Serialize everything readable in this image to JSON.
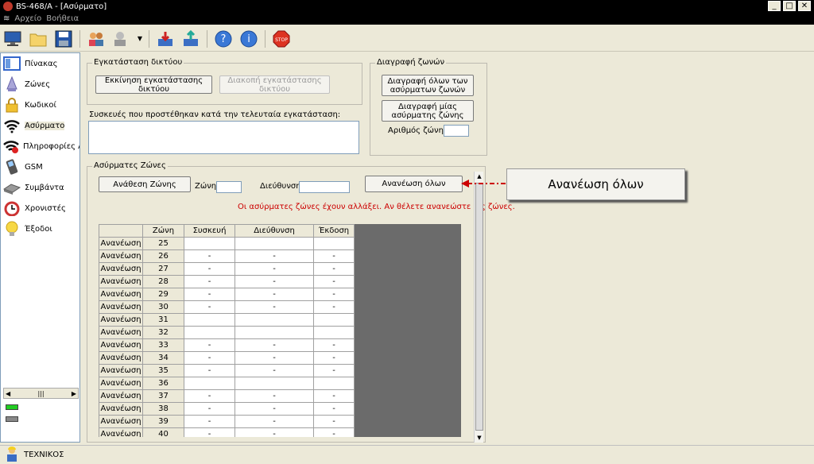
{
  "window": {
    "title": "BS-468/A - [Ασύρματο]",
    "min": "_",
    "max": "□",
    "close": "✕"
  },
  "menu": {
    "items": [
      "Αρχείο",
      "Βοήθεια"
    ]
  },
  "sidebar": {
    "items": [
      {
        "label": "Πίνακας",
        "icon": "panel-icon"
      },
      {
        "label": "Ζώνες",
        "icon": "zones-icon"
      },
      {
        "label": "Κωδικοί",
        "icon": "lock-icon"
      },
      {
        "label": "Ασύρματο",
        "icon": "wifi-icon"
      },
      {
        "label": "Πληροφορίες Ασ",
        "icon": "wifi-info-icon"
      },
      {
        "label": "GSM",
        "icon": "phone-icon"
      },
      {
        "label": "Συμβάντα",
        "icon": "events-icon"
      },
      {
        "label": "Χρονιστές",
        "icon": "clock-icon"
      },
      {
        "label": "Έξοδοι",
        "icon": "bulb-icon"
      }
    ],
    "selected": 3
  },
  "network": {
    "legend": "Εγκατάσταση δικτύου",
    "start_btn": "Εκκίνηση εγκατάστασης δικτύου",
    "stop_btn": "Διακοπή εγκατάστασης δικτύου",
    "devices_label": "Συσκευές που προστέθηκαν κατά την τελευταία εγκατάσταση:"
  },
  "delete": {
    "legend": "Διαγραφή ζωνών",
    "all_btn": "Διαγραφή όλων των ασύρματων ζωνών",
    "one_btn": "Διαγραφή μίας ασύρματης ζώνης",
    "zone_num_label": "Αριθμός ζώνης:",
    "zone_num_value": ""
  },
  "wireless": {
    "legend": "Ασύρματες Ζώνες",
    "assign_btn": "Ανάθεση Ζώνης",
    "zone_label": "Ζώνη",
    "zone_value": "",
    "address_label": "Διεύθυνση",
    "address_value": "",
    "refresh_all_btn": "Ανανέωση όλων",
    "warning": "Οι ασύρματες ζώνες έχουν αλλάξει. Αν θέλετε ανανεώστε τις ζώνες.",
    "warning_color": "#cc0000",
    "columns": [
      "",
      "Ζώνη",
      "Συσκευή",
      "Διεύθυνση",
      "Έκδοση"
    ],
    "rows": [
      {
        "action": "Ανανέωση",
        "zone": "25",
        "device": "",
        "address": "",
        "version": ""
      },
      {
        "action": "Ανανέωση",
        "zone": "26",
        "device": "-",
        "address": "-",
        "version": "-"
      },
      {
        "action": "Ανανέωση",
        "zone": "27",
        "device": "-",
        "address": "-",
        "version": "-"
      },
      {
        "action": "Ανανέωση",
        "zone": "28",
        "device": "-",
        "address": "-",
        "version": "-"
      },
      {
        "action": "Ανανέωση",
        "zone": "29",
        "device": "-",
        "address": "-",
        "version": "-"
      },
      {
        "action": "Ανανέωση",
        "zone": "30",
        "device": "-",
        "address": "-",
        "version": "-"
      },
      {
        "action": "Ανανέωση",
        "zone": "31",
        "device": "",
        "address": "",
        "version": ""
      },
      {
        "action": "Ανανέωση",
        "zone": "32",
        "device": "",
        "address": "",
        "version": ""
      },
      {
        "action": "Ανανέωση",
        "zone": "33",
        "device": "-",
        "address": "-",
        "version": "-"
      },
      {
        "action": "Ανανέωση",
        "zone": "34",
        "device": "-",
        "address": "-",
        "version": "-"
      },
      {
        "action": "Ανανέωση",
        "zone": "35",
        "device": "-",
        "address": "-",
        "version": "-"
      },
      {
        "action": "Ανανέωση",
        "zone": "36",
        "device": "",
        "address": "",
        "version": ""
      },
      {
        "action": "Ανανέωση",
        "zone": "37",
        "device": "-",
        "address": "-",
        "version": "-"
      },
      {
        "action": "Ανανέωση",
        "zone": "38",
        "device": "-",
        "address": "-",
        "version": "-"
      },
      {
        "action": "Ανανέωση",
        "zone": "39",
        "device": "-",
        "address": "-",
        "version": "-"
      },
      {
        "action": "Ανανέωση",
        "zone": "40",
        "device": "-",
        "address": "-",
        "version": "-"
      }
    ]
  },
  "callout": {
    "text": "Ανανέωση όλων",
    "arrow_color": "#cc0000"
  },
  "status": {
    "user": "ΤΕΧΝΙΚΟΣ"
  }
}
